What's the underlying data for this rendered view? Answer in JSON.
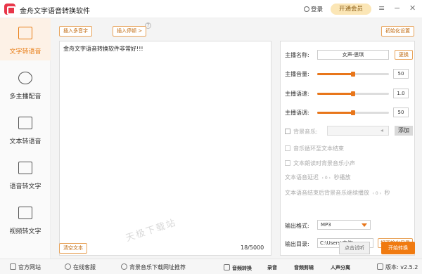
{
  "titlebar": {
    "app_title": "金舟文字语音转换软件",
    "login": "登录",
    "vip": "开通会员",
    "menu_icon": "menu-icon",
    "minimize": "−",
    "close": "✕"
  },
  "sidebar": {
    "items": [
      {
        "label": "文字转语音",
        "icon": "text-to-speech-icon",
        "active": true
      },
      {
        "label": "多主播配音",
        "icon": "multi-speaker-icon"
      },
      {
        "label": "文本转语音",
        "icon": "document-speech-icon"
      },
      {
        "label": "语音转文字",
        "icon": "speech-to-text-icon"
      },
      {
        "label": "视频转文字",
        "icon": "video-to-text-icon"
      }
    ]
  },
  "toolbar": {
    "insert_polyphone": "插入多音字",
    "insert_pause": "插入停顿 >",
    "init_settings": "初始化设置"
  },
  "editor": {
    "content": "金舟文字语音转换软件非常好!!!",
    "watermark": "天极下载站"
  },
  "settings": {
    "anchor_name_label": "主播名称:",
    "anchor_name_value": "女声-思琪",
    "change_button": "更换",
    "volume_label": "主播音量:",
    "volume_value": "50",
    "volume_level": 0.5,
    "speed_label": "主播语速:",
    "speed_value": "1.0",
    "speed_level": 0.5,
    "pitch_label": "主播语调:",
    "pitch_value": "50",
    "pitch_level": 0.5,
    "bgm_label": "背景音乐:",
    "add_button": "添加",
    "loop_label": "音乐循环至文本结束",
    "lower_bgm_label": "文本朗读时背景音乐小声",
    "delay_prefix": "文本语音延迟",
    "delay_value": "0",
    "delay_suffix": "秒播放",
    "continue_prefix": "文本语音结束后背景音乐继续播放",
    "continue_value": "0",
    "continue_suffix": "秒",
    "format_label": "输出格式:",
    "format_value": "MP3",
    "dir_label": "输出目录:",
    "dir_value": "C:\\Users\\志伟\\",
    "open_dir_button": "打开输出目录"
  },
  "bottom": {
    "clear_button": "清空文本",
    "counter": "18/5000",
    "preview_button": "点击试听",
    "convert_button": "开始转换"
  },
  "footer": {
    "website": "官方网站",
    "service": "在线客服",
    "bgm_sites": "背景音乐下载网址推荐",
    "audio_convert": "音频转换",
    "record": "录音",
    "audio_cut": "音频剪辑",
    "vocal_split": "人声分离",
    "version": "版本: v2.5.2"
  },
  "colors": {
    "accent": "#e8761a",
    "brand": "#e8364a",
    "active_bg": "#fdf1e6"
  }
}
